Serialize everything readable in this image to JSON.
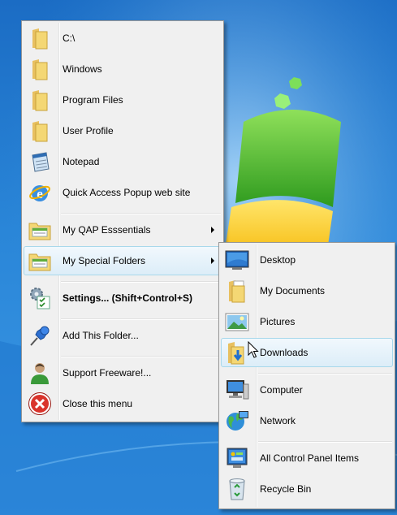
{
  "main_menu": {
    "items": [
      {
        "label": "C:\\",
        "icon": "folder-icon"
      },
      {
        "label": "Windows",
        "icon": "folder-icon"
      },
      {
        "label": "Program Files",
        "icon": "folder-icon"
      },
      {
        "label": "User Profile",
        "icon": "folder-icon"
      },
      {
        "label": "Notepad",
        "icon": "notepad-icon"
      },
      {
        "label": "Quick Access Popup web site",
        "icon": "internet-explorer-icon"
      },
      {
        "label": "My QAP Esssentials",
        "icon": "folder-menu-icon"
      },
      {
        "label": "My Special Folders",
        "icon": "folder-menu-icon"
      },
      {
        "label": "Settings... (Shift+Control+S)",
        "icon": "settings-icon"
      },
      {
        "label": "Add This Folder...",
        "icon": "pushpin-icon"
      },
      {
        "label": "Support Freeware!...",
        "icon": "user-icon"
      },
      {
        "label": "Close this menu",
        "icon": "close-icon"
      }
    ]
  },
  "submenu": {
    "items": [
      {
        "label": "Desktop",
        "icon": "desktop-icon"
      },
      {
        "label": "My Documents",
        "icon": "documents-folder-icon"
      },
      {
        "label": "Pictures",
        "icon": "pictures-icon"
      },
      {
        "label": "Downloads",
        "icon": "downloads-folder-icon"
      },
      {
        "label": "Computer",
        "icon": "computer-icon"
      },
      {
        "label": "Network",
        "icon": "network-icon"
      },
      {
        "label": "All Control Panel Items",
        "icon": "control-panel-icon"
      },
      {
        "label": "Recycle Bin",
        "icon": "recycle-bin-icon"
      }
    ]
  },
  "colors": {
    "menu_bg": "#f0f0f0",
    "hover_border": "#a8d8eb",
    "desktop_blue": "#2a86d8",
    "logo_green": "#3fae2a"
  }
}
